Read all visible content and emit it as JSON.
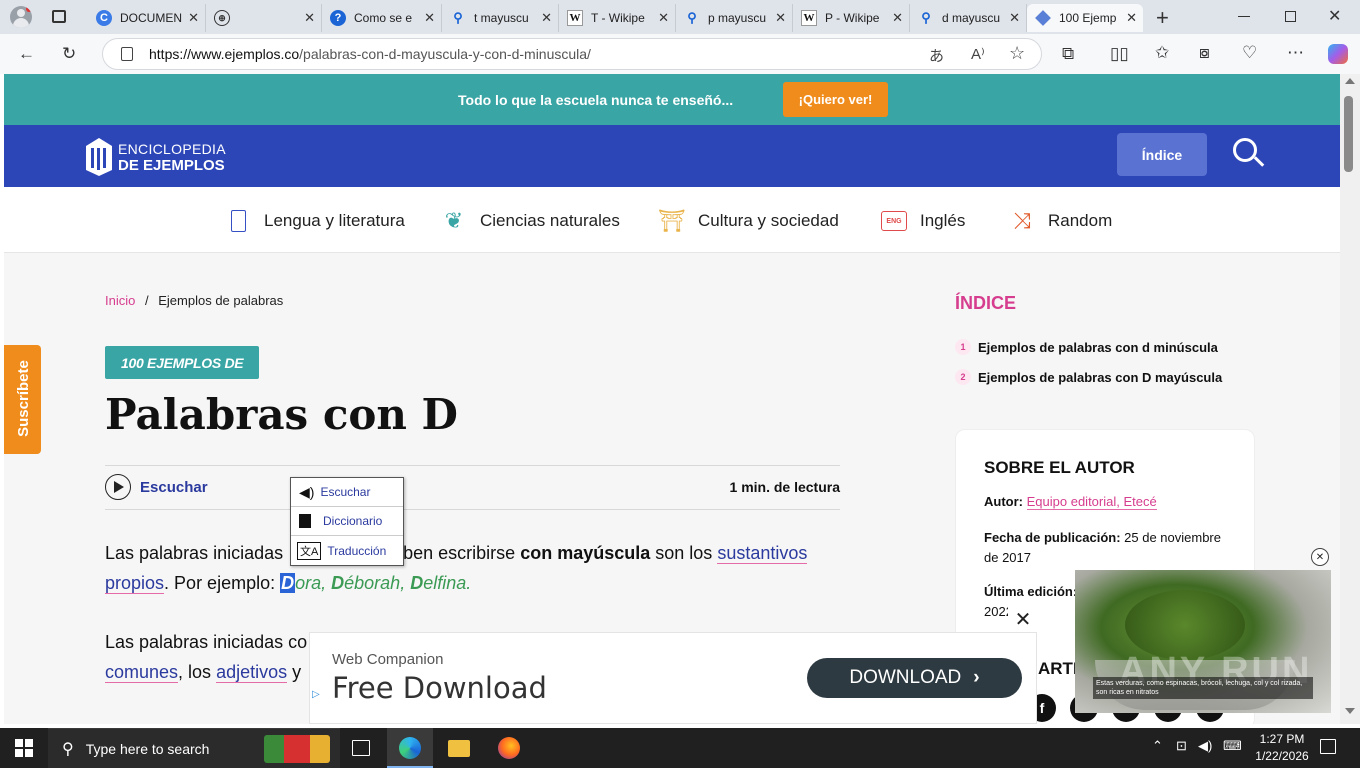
{
  "browser": {
    "tabs": [
      {
        "label": "DOCUMEN",
        "icon": "copilot-icon"
      },
      {
        "label": "",
        "icon": "globe-icon"
      },
      {
        "label": "Como se e",
        "icon": "help-icon"
      },
      {
        "label": "t mayuscu",
        "icon": "search-icon"
      },
      {
        "label": "T - Wikipe",
        "icon": "wikipedia-icon"
      },
      {
        "label": "p mayuscu",
        "icon": "search-icon"
      },
      {
        "label": "P - Wikipe",
        "icon": "wikipedia-icon"
      },
      {
        "label": "d mayuscu",
        "icon": "search-icon"
      },
      {
        "label": "100 Ejemp",
        "icon": "cube-icon"
      }
    ],
    "url_domain": "https://www.ejemplos.co",
    "url_path": "/palabras-con-d-mayuscula-y-con-d-minuscula/"
  },
  "promo": {
    "text": "Todo lo que la escuela nunca te enseñó...",
    "button": "¡Quiero ver!"
  },
  "header": {
    "logo_line1": "ENCICLOPEDIA",
    "logo_line2": "DE EJEMPLOS",
    "index_button": "Índice"
  },
  "nav": [
    {
      "label": "Lengua y literatura"
    },
    {
      "label": "Ciencias naturales"
    },
    {
      "label": "Cultura y sociedad"
    },
    {
      "label": "Inglés"
    },
    {
      "label": "Random"
    }
  ],
  "subscribe": "Suscríbete",
  "breadcrumb": {
    "home": "Inicio",
    "sep": "/",
    "current": "Ejemplos de palabras"
  },
  "article": {
    "badge": "100 EJEMPLOS DE",
    "title": "Palabras con D",
    "listen": "Escuchar",
    "read_time": "1 min. de lectura",
    "p1_a": "Las palabras iniciadas",
    "p1_b": "eben escribirse ",
    "p1_bold": "con mayúscula",
    "p1_c": " son los ",
    "p1_link1": "sustantivos",
    "p1_link2": "propios",
    "p1_d": ". Por ejemplo: ",
    "ex_sel": "D",
    "ex_rest1": "ora, ",
    "ex_d2": "D",
    "ex_rest2": "éborah, ",
    "ex_d3": "D",
    "ex_rest3": "elfina.",
    "p2_a": "Las palabras iniciadas co",
    "p2_link1": "comunes",
    "p2_b": ", los ",
    "p2_link2": "adjetivos",
    "p2_c": " y"
  },
  "context_menu": [
    {
      "label": "Escuchar",
      "icon": "speaker-icon"
    },
    {
      "label": "Diccionario",
      "icon": "book-icon"
    },
    {
      "label": "Traducción",
      "icon": "translate-icon"
    }
  ],
  "sidebar": {
    "index_title": "ÍNDICE",
    "index_items": [
      {
        "num": "1",
        "label": "Ejemplos de palabras con d minúscula"
      },
      {
        "num": "2",
        "label": "Ejemplos de palabras con D mayúscula"
      }
    ],
    "author_title": "SOBRE EL AUTOR",
    "author_label": "Autor:",
    "author_value": "Equipo editorial, Etecé",
    "pub_label": "Fecha de publicación:",
    "pub_value": "25 de noviembre de 2017",
    "edit_label": "Última edición:",
    "edit_value": "2022",
    "share_partial": "ARTI"
  },
  "ad": {
    "brand": "Web Companion",
    "headline": "Free Download",
    "button": "DOWNLOAD"
  },
  "video_ad": {
    "caption": "Estas verduras, como espinacas, brócoli, lechuga, col y col rizada, son ricas en nitratos",
    "watermark": "ANY RUN"
  },
  "taskbar": {
    "search_placeholder": "Type here to search",
    "time": "1:27 PM",
    "date": "1/22/2026"
  },
  "colors": {
    "teal": "#3aa5a5",
    "blue": "#2c46b8",
    "orange": "#f08c1c",
    "pink": "#d63d8e",
    "green": "#3b9a54",
    "link": "#2b3a9e"
  }
}
